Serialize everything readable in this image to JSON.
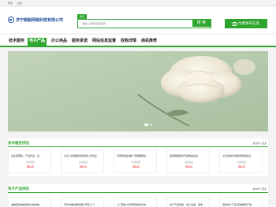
{
  "topbar": {
    "login": "登录",
    "register": "注册"
  },
  "brand": {
    "name": "济宁朗毅网络科技有限公司"
  },
  "search": {
    "tab": "供应",
    "placeholder": "请输入关键词供应名称",
    "button": "搜 索"
  },
  "publish": {
    "label": "付费发布信息"
  },
  "nav": {
    "items": [
      {
        "label": "技术服务",
        "active": false
      },
      {
        "label": "电子产品",
        "active": true
      },
      {
        "label": "办公用品",
        "active": false
      },
      {
        "label": "服务承诺",
        "active": false
      },
      {
        "label": "网站信息监督",
        "active": false
      },
      {
        "label": "收购详情",
        "active": false
      },
      {
        "label": "商机推荐",
        "active": false
      }
    ]
  },
  "banner": {
    "image": "white-peony-flower"
  },
  "sections": [
    {
      "title": "技术服务供应",
      "more": "发布供 | 更多",
      "cards": [
        {
          "title": "企业官网建、产品售后、企...",
          "label": "供货商机",
          "date": "08-21"
        },
        {
          "title": "山东小新网络科技有限公司企业...",
          "label": "供货商机",
          "date": "08-21"
        },
        {
          "title": "济南网站建/推广济南做网站...",
          "label": "供货商机",
          "date": "08-21"
        },
        {
          "title": "淄博网络软件开发网站建设、...",
          "label": "供货商机",
          "date": "08-21"
        },
        {
          "title": "山东优技术到服务网站建设...",
          "label": "供货商机",
          "date": "08-21"
        }
      ]
    },
    {
      "title": "电子产品供应",
      "more": "发布供 | 更多",
      "cards": [
        {
          "title": "电脑回收电脑回收价格电脑..."
        },
        {
          "title": "手机/电脑/数码回收 济南上门..."
        },
        {
          "title": "上门回收 在济南回收笔记本..."
        },
        {
          "title": "电子产品回收、电子设备、回收..."
        },
        {
          "title": "回收电子产品 回收数码产品..."
        }
      ]
    }
  ],
  "colors": {
    "accent": "#2ea52e",
    "date": "#e33333",
    "brand": "#1f4f9a"
  }
}
